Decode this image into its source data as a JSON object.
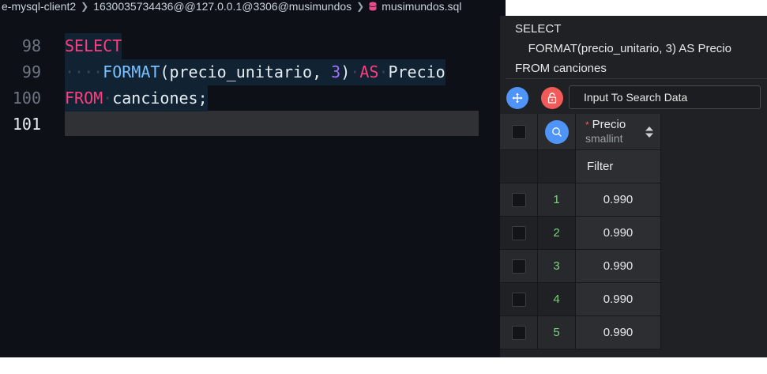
{
  "breadcrumb": {
    "segments": [
      "e-mysql-client2",
      "1630035734436@@127.0.0.1@3306@musimundos",
      "musimundos.sql"
    ]
  },
  "editor": {
    "lines": [
      {
        "num": "98",
        "tokens": [
          {
            "t": "SELECT",
            "c": "kw"
          }
        ]
      },
      {
        "num": "99",
        "tokens": [
          {
            "t": "····",
            "c": "ws"
          },
          {
            "t": "FORMAT",
            "c": "fn"
          },
          {
            "t": "(precio_unitario, ",
            "c": "plain"
          },
          {
            "t": "3",
            "c": "num"
          },
          {
            "t": ")",
            "c": "plain"
          },
          {
            "t": "·",
            "c": "ws"
          },
          {
            "t": "AS",
            "c": "kw"
          },
          {
            "t": "·",
            "c": "ws"
          },
          {
            "t": "Precio",
            "c": "plain"
          }
        ]
      },
      {
        "num": "100",
        "tokens": [
          {
            "t": "FROM",
            "c": "kw"
          },
          {
            "t": "·",
            "c": "ws"
          },
          {
            "t": "canciones;",
            "c": "plain"
          }
        ]
      },
      {
        "num": "101",
        "tokens": []
      }
    ]
  },
  "query": {
    "lines": [
      "SELECT",
      "    FORMAT(precio_unitario, 3) AS Precio",
      "FROM canciones"
    ]
  },
  "toolbar": {
    "search_placeholder": "Input To Search Data"
  },
  "grid": {
    "column": {
      "name": "Precio",
      "type": "smallint"
    },
    "filter_label": "Filter",
    "rows": [
      {
        "n": "1",
        "v": "0.990"
      },
      {
        "n": "2",
        "v": "0.990"
      },
      {
        "n": "3",
        "v": "0.990"
      },
      {
        "n": "4",
        "v": "0.990"
      },
      {
        "n": "5",
        "v": "0.990"
      }
    ]
  },
  "colors": {
    "keyword": "#ff3d7f",
    "function": "#79c0ff",
    "number": "#a371f7",
    "accent": "#4f94f9",
    "danger": "#f25a5a",
    "rownum": "#7ed07e"
  }
}
